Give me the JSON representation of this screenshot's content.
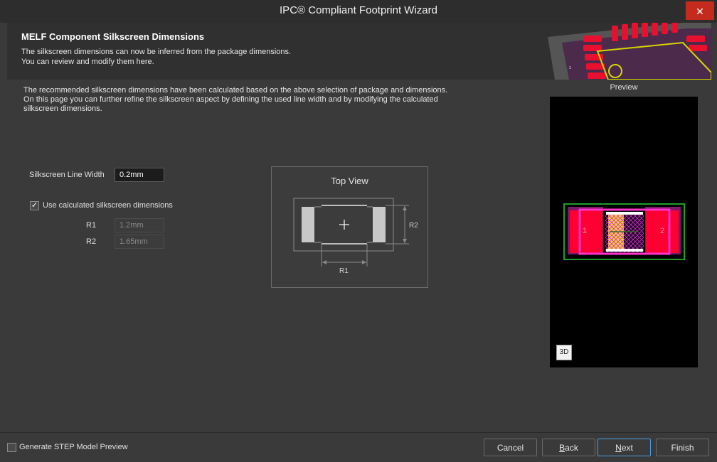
{
  "window": {
    "title": "IPC® Compliant Footprint Wizard",
    "close_glyph": "✕"
  },
  "header": {
    "title": "MELF Component Silkscreen Dimensions",
    "subtitle_line1": "The silkscreen dimensions can now be inferred from the package dimensions.",
    "subtitle_line2": "You can review and modify them here."
  },
  "description": {
    "line1": "The recommended silkscreen dimensions have been calculated based on the above selection of package and dimensions.",
    "line2": "On this page you can further refine the silkscreen aspect by defining the used line width and by modifying the calculated",
    "line3": "silkscreen dimensions."
  },
  "form": {
    "line_width_label": "Silkscreen Line Width",
    "line_width_value": "0.2mm",
    "use_calculated_label": "Use calculated silkscreen dimensions",
    "use_calculated_checked": true,
    "r1_label": "R1",
    "r1_value": "1.2mm",
    "r2_label": "R2",
    "r2_value": "1.65mm"
  },
  "top_view": {
    "title": "Top View",
    "r1_label": "R1",
    "r2_label": "R2"
  },
  "preview": {
    "label": "Preview",
    "pad1": "1",
    "pad2": "2",
    "btn_3d": "3D"
  },
  "footer": {
    "step_label": "Generate STEP Model Preview",
    "step_checked": false,
    "cancel": "Cancel",
    "back_mnemonic": "B",
    "back_rest": "ack",
    "next_mnemonic": "N",
    "next_rest": "ext",
    "finish": "Finish"
  },
  "colors": {
    "accent": "#4a9ede",
    "pad_red": "#ff0033",
    "silk_magenta": "#ff33cc",
    "courtyard_green": "#22aa22",
    "body_yellow": "#ffcc33"
  }
}
